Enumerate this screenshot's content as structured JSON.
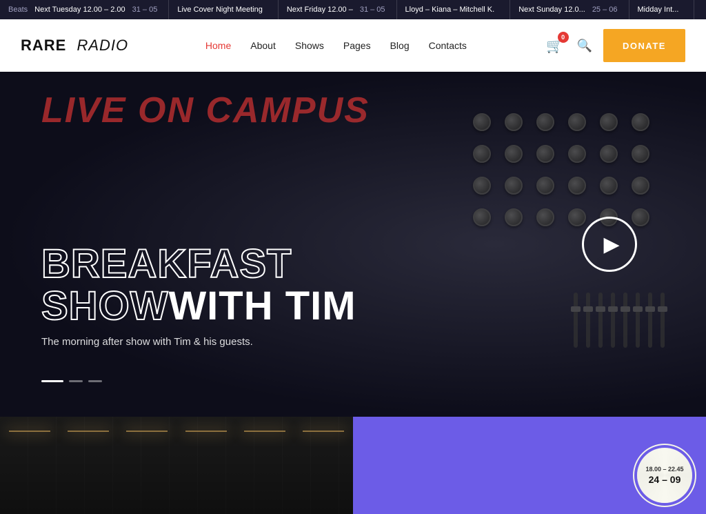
{
  "ticker": {
    "segments": [
      {
        "label": "Beats",
        "event": "Next Tuesday 12.00 – 2.00",
        "date": "31 – 05"
      },
      {
        "label": "",
        "event": "Live Cover Night Meeting",
        "date": ""
      },
      {
        "label": "",
        "event": "Next Friday 12.00 –",
        "date": "31 – 05"
      },
      {
        "label": "",
        "event": "Lloyd – Kiana – Mitchell K.",
        "date": ""
      },
      {
        "label": "",
        "event": "Next Sunday 12.0...",
        "date": "25 – 06"
      },
      {
        "label": "",
        "event": "Midday Int...",
        "date": ""
      }
    ]
  },
  "header": {
    "logo_rare": "RARE",
    "logo_radio": "RADIO",
    "nav": [
      {
        "label": "Home",
        "active": true
      },
      {
        "label": "About",
        "active": false
      },
      {
        "label": "Shows",
        "active": false
      },
      {
        "label": "Pages",
        "active": false
      },
      {
        "label": "Blog",
        "active": false
      },
      {
        "label": "Contacts",
        "active": false
      }
    ],
    "cart_count": "0",
    "donate_label": "DONATE"
  },
  "hero": {
    "live_text": "LIVE ON CAMPUS",
    "title_line1": "BREAKFAST",
    "title_line2_outline": "SHOW",
    "title_line2_solid": " WITH TIM",
    "subtitle": "The morning after show with Tim & his guests.",
    "play_button_label": "Play",
    "indicators": [
      {
        "active": true
      },
      {
        "active": false
      },
      {
        "active": false
      }
    ]
  },
  "bottom": {
    "badge_time": "18.00 – 22.45",
    "badge_date": "24 – 09"
  }
}
